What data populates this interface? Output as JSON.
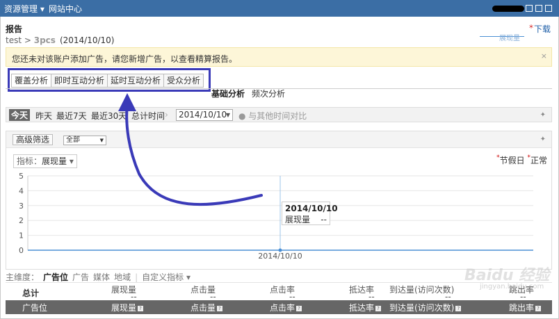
{
  "topbar": {
    "menu1": "资源管理 ▾",
    "menu2": "网站中心"
  },
  "header": {
    "title": "报告",
    "breadcrumb_root": "test",
    "breadcrumb_sep": " > ",
    "breadcrumb_current": "3pcs",
    "date_range": "(2014/10/10)",
    "download": "下载"
  },
  "notice": {
    "text": "您还未对该账户添加广告，请您新增广告，以查看精算报告。",
    "close": "×"
  },
  "tabs": [
    "覆盖分析",
    "即时互动分析",
    "延时互动分析",
    "受众分析"
  ],
  "subtabs": [
    "基础分析",
    "频次分析"
  ],
  "datebar": {
    "today": "今天",
    "yesterday": "昨天",
    "last7": "最近7天",
    "last30": "最近30天",
    "total": "总计时间",
    "date_value": "2014/10/10",
    "compare": "与其他时间对比"
  },
  "filter": {
    "advanced": "高级筛选",
    "select_value": "全部"
  },
  "metric": {
    "label": "指标：",
    "value": "展现量",
    "arrow": "▾"
  },
  "legend": {
    "holiday": "节假日",
    "normal": "正常",
    "series": "展现量"
  },
  "chart_data": {
    "type": "line",
    "categories": [
      "2014/10/10"
    ],
    "series": [
      {
        "name": "展现量",
        "values": [
          0
        ]
      }
    ],
    "y_ticks": [
      "0",
      "1",
      "2",
      "3",
      "4",
      "5"
    ],
    "ylim": [
      0,
      5
    ],
    "grid": true,
    "series_color": "#4a8fd4"
  },
  "tooltip": {
    "date": "2014/10/10",
    "metric": "展现量",
    "value": "--"
  },
  "dimensions": {
    "label": "主维度：",
    "items": [
      "广告位",
      "广告",
      "媒体",
      "地域"
    ],
    "custom": "自定义指标 ▾"
  },
  "table": {
    "total_label": "总计",
    "total_cols": [
      {
        "name": "展现量",
        "value": "--"
      },
      {
        "name": "点击量",
        "value": "--"
      },
      {
        "name": "点击率",
        "value": "--"
      },
      {
        "name": "抵达率",
        "value": "--"
      },
      {
        "name": "到达量(访问次数)",
        "value": "--"
      },
      {
        "name": "跳出率",
        "value": "--"
      }
    ],
    "headers": [
      "广告位",
      "展现量",
      "点击量",
      "点击率",
      "抵达率",
      "到达量(访问次数)",
      "跳出率"
    ]
  },
  "watermark": {
    "brand": "Baidu 经验",
    "url": "jingyan.baidu.com"
  }
}
